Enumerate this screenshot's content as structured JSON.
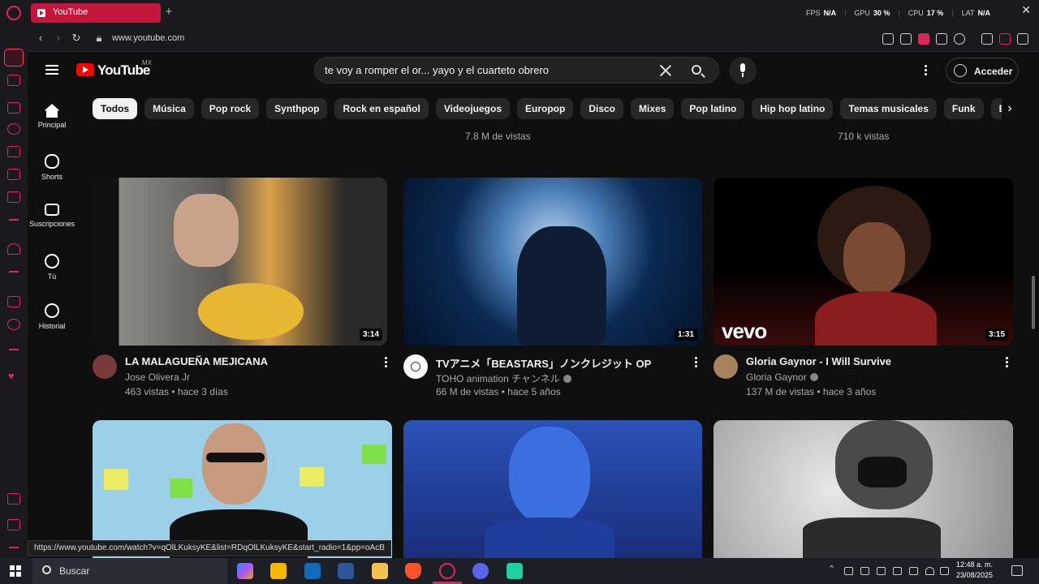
{
  "browser": {
    "tab_title": "YouTube",
    "url": "www.youtube.com",
    "stats": [
      {
        "label": "FPS",
        "value": "N/A"
      },
      {
        "label": "GPU",
        "value": "30 %"
      },
      {
        "label": "CPU",
        "value": "17 %"
      },
      {
        "label": "LAT",
        "value": "N/A"
      }
    ],
    "status_link": "https://www.youtube.com/watch?v=qOlLKuksyKE&list=RDqOlLKuksyKE&start_radio=1&pp=oAcB"
  },
  "yt": {
    "logo_text": "YouTube",
    "region": "MX",
    "search_value": "te voy a romper el or... yayo y el cuarteto obrero",
    "signin_label": "Acceder",
    "rail": [
      {
        "label": "Principal"
      },
      {
        "label": "Shorts"
      },
      {
        "label": "Suscripciones"
      },
      {
        "label": "Tú"
      },
      {
        "label": "Historial"
      }
    ],
    "chips": [
      "Todos",
      "Música",
      "Pop rock",
      "Synthpop",
      "Rock en español",
      "Videojuegos",
      "Europop",
      "Disco",
      "Mixes",
      "Pop latino",
      "Hip hop latino",
      "Temas musicales",
      "Funk",
      "Electro house"
    ],
    "prev_views": [
      "7.8 M de vistas",
      "710 k vistas"
    ],
    "videos": [
      {
        "title": "LA MALAGUEÑA MEJICANA",
        "channel": "Jose Olivera Jr",
        "meta": "463 vistas • hace 3 días",
        "duration": "3:14"
      },
      {
        "title": "TVアニメ「BEASTARS」ノンクレジット OP",
        "channel": "TOHO animation チャンネル",
        "meta": "66 M de vistas • hace 5 años",
        "duration": "1:31"
      },
      {
        "title": "Gloria Gaynor - I Will Survive",
        "channel": "Gloria Gaynor",
        "meta": "137 M de vistas • hace 3 años",
        "duration": "3:15",
        "thumb_text": "vevo"
      }
    ]
  },
  "taskbar": {
    "search_label": "Buscar",
    "time": "12:48 a. m.",
    "date": "23/08/2025"
  }
}
